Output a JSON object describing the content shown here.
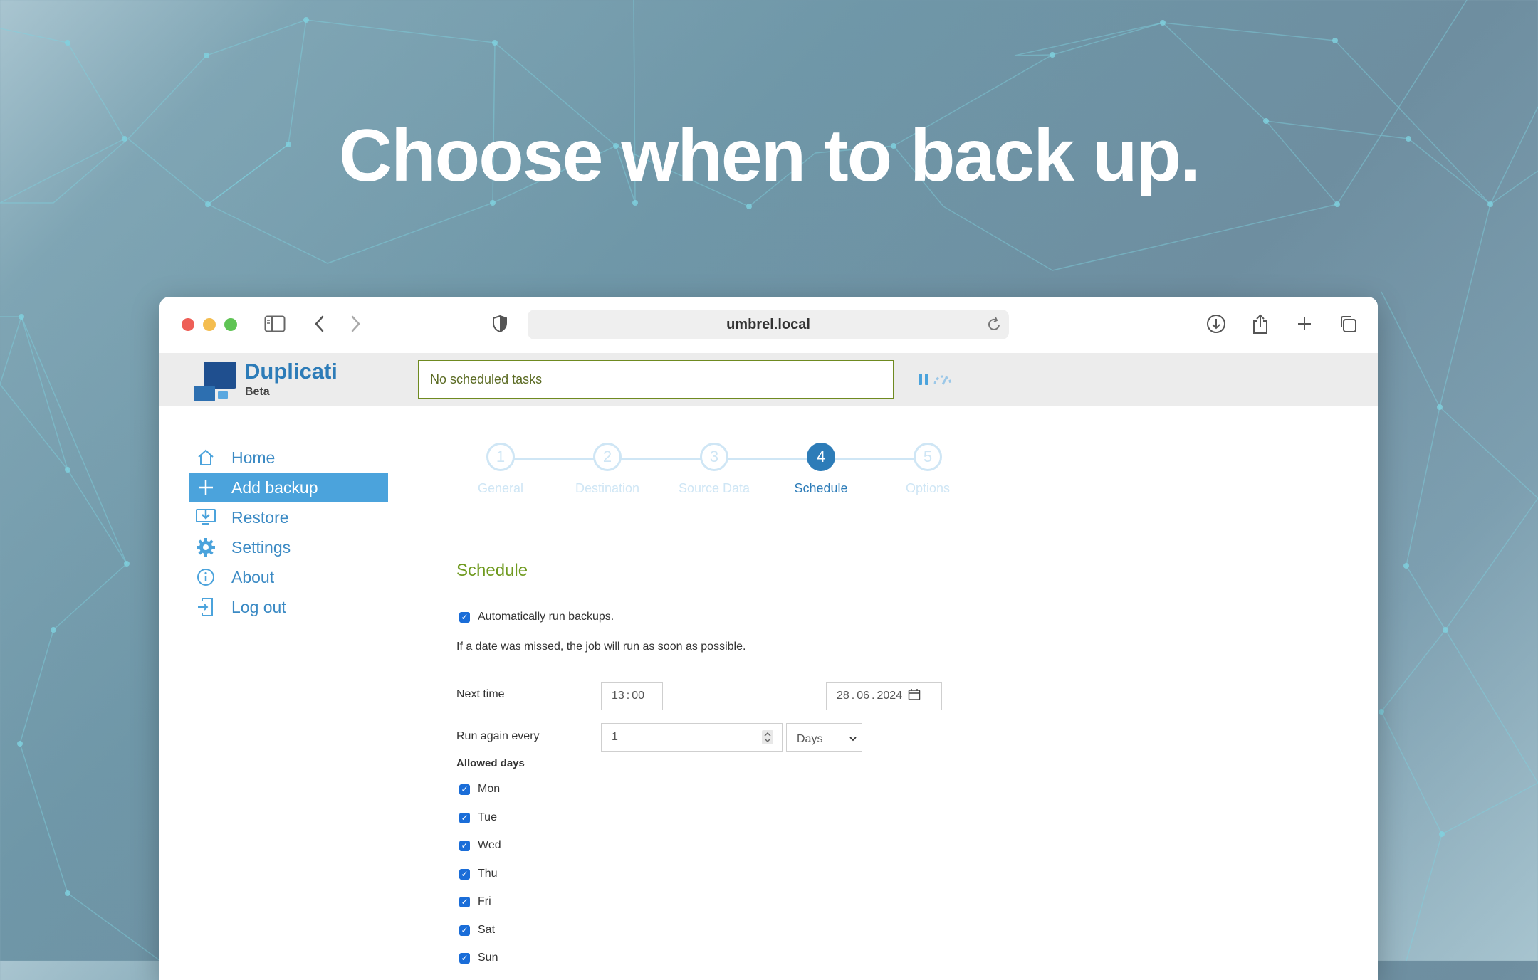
{
  "headline": "Choose when to back up.",
  "browser": {
    "url": "umbrel.local"
  },
  "app": {
    "title": "Duplicati",
    "subtitle": "Beta",
    "status": "No scheduled tasks"
  },
  "nav": {
    "items": [
      {
        "label": "Home",
        "icon": "home-icon"
      },
      {
        "label": "Add backup",
        "icon": "plus-icon",
        "active": true
      },
      {
        "label": "Restore",
        "icon": "restore-icon"
      },
      {
        "label": "Settings",
        "icon": "gear-icon"
      },
      {
        "label": "About",
        "icon": "info-icon"
      },
      {
        "label": "Log out",
        "icon": "logout-icon"
      }
    ]
  },
  "steps": [
    {
      "num": "1",
      "label": "General"
    },
    {
      "num": "2",
      "label": "Destination"
    },
    {
      "num": "3",
      "label": "Source Data"
    },
    {
      "num": "4",
      "label": "Schedule",
      "active": true
    },
    {
      "num": "5",
      "label": "Options"
    }
  ],
  "schedule": {
    "title": "Schedule",
    "auto_run_label": "Automatically run backups.",
    "missed_info": "If a date was missed, the job will run as soon as possible.",
    "next_time_label": "Next time",
    "time_hh": "13",
    "time_mm": "00",
    "date_dd": "28",
    "date_mm": "06",
    "date_yyyy": "2024",
    "run_again_label": "Run again every",
    "run_again_value": "1",
    "run_again_unit": "Days",
    "allowed_days_label": "Allowed days",
    "days": [
      "Mon",
      "Tue",
      "Wed",
      "Thu",
      "Fri",
      "Sat",
      "Sun"
    ]
  },
  "colors": {
    "accent": "#2d7cb8",
    "nav_active_bg": "#4ba3dc",
    "section_title": "#6f9a1f",
    "checkbox": "#1a6dd8"
  }
}
